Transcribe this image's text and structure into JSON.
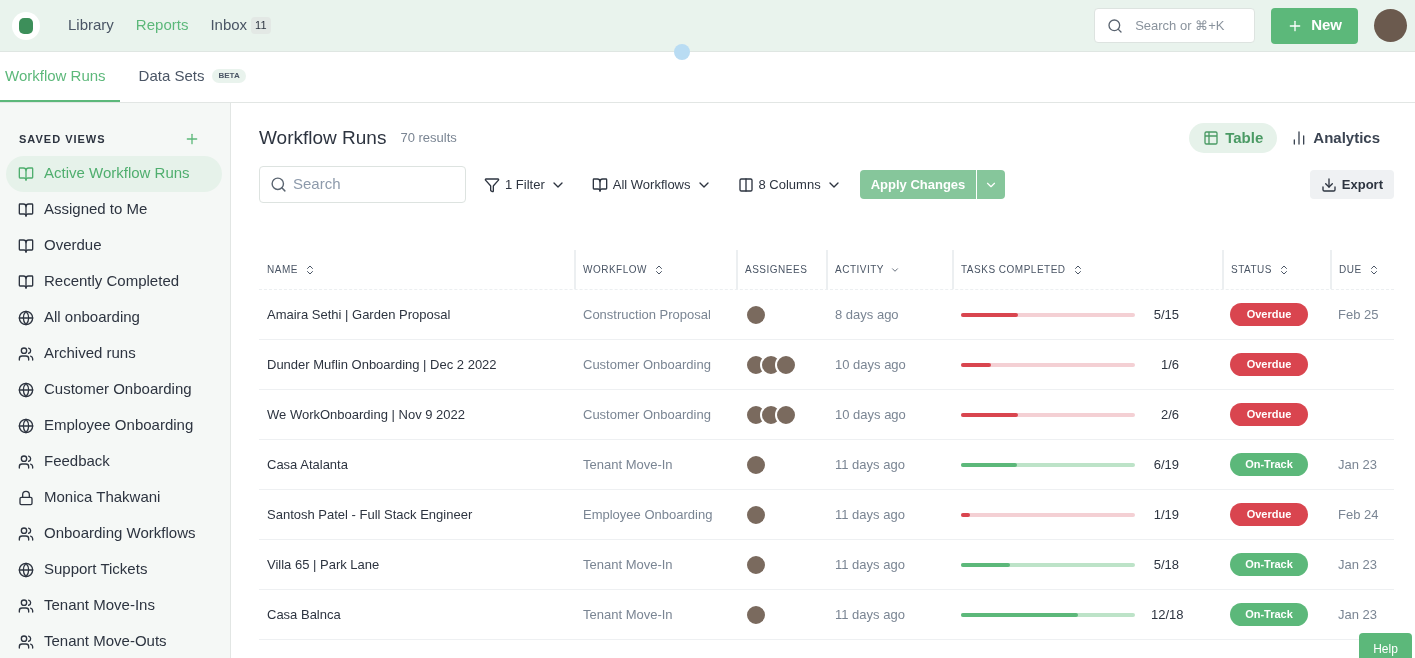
{
  "nav": {
    "items": [
      {
        "label": "Library",
        "selected": false
      },
      {
        "label": "Reports",
        "selected": true
      },
      {
        "label": "Inbox",
        "selected": false,
        "badge": "11"
      }
    ],
    "search": {
      "placeholder": "Search or ⌘+K"
    },
    "new_button": "New"
  },
  "tabs": [
    {
      "label": "Workflow Runs",
      "selected": true
    },
    {
      "label": "Data Sets",
      "selected": false,
      "badge": "BETA"
    }
  ],
  "sidebar": {
    "heading": "SAVED VIEWS",
    "items": [
      {
        "label": "Active Workflow Runs",
        "kind": "book",
        "selected": true
      },
      {
        "label": "Assigned to Me",
        "kind": "book",
        "selected": false
      },
      {
        "label": "Overdue",
        "kind": "book",
        "selected": false
      },
      {
        "label": "Recently Completed",
        "kind": "book",
        "selected": false
      },
      {
        "label": "All onboarding",
        "kind": "globe",
        "selected": false
      },
      {
        "label": "Archived runs",
        "kind": "team",
        "selected": false
      },
      {
        "label": "Customer Onboarding",
        "kind": "globe",
        "selected": false
      },
      {
        "label": "Employee Onboarding",
        "kind": "globe",
        "selected": false
      },
      {
        "label": "Feedback",
        "kind": "team",
        "selected": false
      },
      {
        "label": "Monica Thakwani",
        "kind": "private",
        "selected": false
      },
      {
        "label": "Onboarding Workflows",
        "kind": "team",
        "selected": false
      },
      {
        "label": "Support Tickets",
        "kind": "globe",
        "selected": false
      },
      {
        "label": "Tenant Move-Ins",
        "kind": "team",
        "selected": false
      },
      {
        "label": "Tenant Move-Outs",
        "kind": "team",
        "selected": false
      }
    ]
  },
  "header": {
    "title": "Workflow Runs",
    "count": "70 results",
    "views": [
      {
        "label": "Table",
        "selected": true
      },
      {
        "label": "Analytics",
        "selected": false
      }
    ]
  },
  "toolbar": {
    "search": {
      "placeholder": "Search"
    },
    "filters": [
      "1 Filter",
      "All Workflows",
      "8 Columns"
    ],
    "apply": {
      "label": "Apply Changes",
      "disabled": true
    },
    "export": "Export"
  },
  "table": {
    "columns": [
      {
        "label": "NAME",
        "kind": "sortable"
      },
      {
        "label": "WORKFLOW",
        "kind": "sortable"
      },
      {
        "label": "ASSIGNEES",
        "kind": "plain"
      },
      {
        "label": "ACTIVITY",
        "kind": "sorted"
      },
      {
        "label": "TASKS COMPLETED",
        "kind": "sortable"
      },
      {
        "label": "STATUS",
        "kind": "sortable"
      },
      {
        "label": "DUE",
        "kind": "sortable"
      }
    ],
    "rows": [
      {
        "name": "Amaira Sethi | Garden Proposal",
        "workflow": "Construction Proposal",
        "assignees": [
          {
            "kind": "photo"
          }
        ],
        "activity": "8 days ago",
        "level": 0.33,
        "tasks": "5/15",
        "status": {
          "label": "Overdue",
          "kind": "overdue"
        },
        "due": "Feb 25"
      },
      {
        "name": "Dunder Muflin Onboarding | Dec 2 2022",
        "workflow": "Customer Onboarding",
        "assignees": [
          {
            "kind": "photo"
          },
          {
            "kind": "photo"
          },
          {
            "kind": "photo"
          }
        ],
        "activity": "10 days ago",
        "level": 0.17,
        "tasks": "1/6",
        "status": {
          "label": "Overdue",
          "kind": "overdue"
        }
      },
      {
        "name": "We WorkOnboarding | Nov 9 2022",
        "workflow": "Customer Onboarding",
        "assignees": [
          {
            "kind": "photo"
          },
          {
            "kind": "photo"
          },
          {
            "kind": "photo"
          }
        ],
        "activity": "10 days ago",
        "level": 0.33,
        "tasks": "2/6",
        "status": {
          "label": "Overdue",
          "kind": "overdue"
        }
      },
      {
        "name": "Casa Atalanta",
        "workflow": "Tenant Move-In",
        "assignees": [
          {
            "kind": "photo"
          }
        ],
        "activity": "11 days ago",
        "level": 0.32,
        "tasks": "6/19",
        "status": {
          "label": "On-Track",
          "kind": "ontrack"
        },
        "due": "Jan 23"
      },
      {
        "name": "Santosh Patel - Full Stack Engineer",
        "workflow": "Employee Onboarding",
        "assignees": [
          {
            "kind": "photo"
          }
        ],
        "activity": "11 days ago",
        "level": 0.05,
        "tasks": "1/19",
        "status": {
          "label": "Overdue",
          "kind": "overdue"
        },
        "due": "Feb 24"
      },
      {
        "name": "Villa 65 | Park Lane",
        "workflow": "Tenant Move-In",
        "assignees": [
          {
            "kind": "photo"
          }
        ],
        "activity": "11 days ago",
        "level": 0.28,
        "tasks": "5/18",
        "status": {
          "label": "On-Track",
          "kind": "ontrack"
        },
        "due": "Jan 23"
      },
      {
        "name": "Casa Balnca",
        "workflow": "Tenant Move-In",
        "assignees": [
          {
            "kind": "photo"
          }
        ],
        "activity": "11 days ago",
        "level": 0.67,
        "tasks": "12/18",
        "status": {
          "label": "On-Track",
          "kind": "ontrack"
        },
        "due": "Jan 23"
      }
    ]
  },
  "help": "Help"
}
